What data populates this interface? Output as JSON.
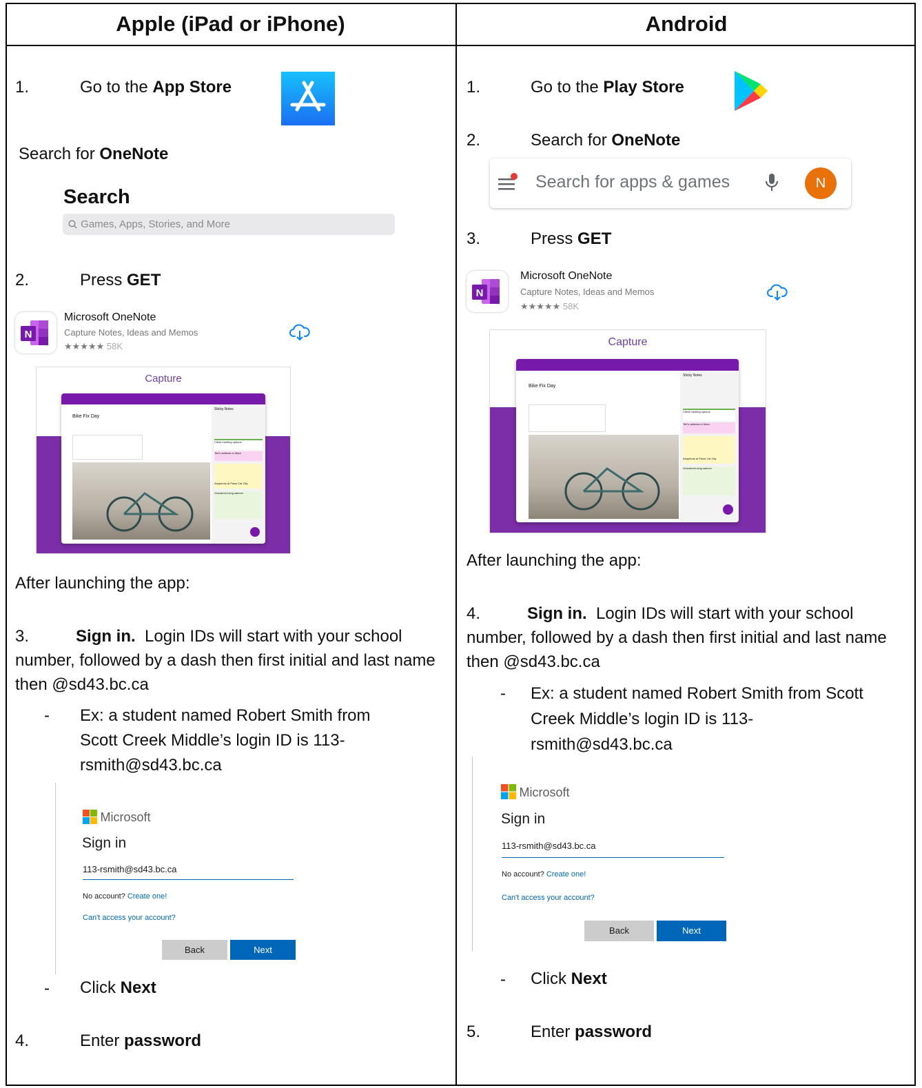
{
  "headers": {
    "apple": "Apple (iPad or iPhone)",
    "android": "Android"
  },
  "apple": {
    "step1_num": "1.",
    "step1_pre": "Go to the ",
    "step1_bold": "App Store",
    "search_pre": "Search for ",
    "search_bold": "OneNote",
    "ios_search_title": "Search",
    "ios_search_placeholder": "Games, Apps, Stories, and More",
    "step2_num": "2.",
    "step2_pre": "Press ",
    "step2_bold": "GET",
    "after": "After launching the app:",
    "step3_num": "3.",
    "step3_bold": "Sign in.",
    "step3_text": "Login IDs will start with your school number, followed by a dash then first initial and last name then @sd43.bc.ca",
    "example": "Ex: a student named Robert Smith from Scott Creek Middle’s login ID is  113-rsmith@sd43.bc.ca",
    "dash": "-",
    "click_pre": "Click ",
    "click_bold": "Next",
    "step4_num": "4.",
    "step4_pre": "Enter ",
    "step4_bold": "password"
  },
  "android": {
    "step1_num": "1.",
    "step1_pre": "Go to the ",
    "step1_bold": "Play Store",
    "step2_num": "2.",
    "step2_pre": "Search for ",
    "step2_bold": "OneNote",
    "gp_search_placeholder": "Search for apps & games",
    "avatar_letter": "N",
    "step3_num": "3.",
    "step3_pre": "Press ",
    "step3_bold": "GET",
    "after": "After launching the app:",
    "step4_num": "4.",
    "step4_bold": "Sign in.",
    "step4_text": "Login IDs will start with your school number, followed by a dash then first initial and last name then @sd43.bc.ca",
    "example": "Ex: a student named Robert Smith from Scott Creek Middle’s login ID is  113-rsmith@sd43.bc.ca",
    "dash": "-",
    "click_pre": "Click ",
    "click_bold": "Next",
    "step5_num": "5.",
    "step5_pre": "Enter ",
    "step5_bold": "password"
  },
  "app_listing": {
    "name": "Microsoft OneNote",
    "subtitle": "Capture Notes, Ideas and Memos",
    "stars": "★★★★★",
    "rating_count": "58K",
    "icon_letter": "N",
    "capture_label": "Capture",
    "page_title": "Bike Fix Day",
    "sticky_header": "Sticky Notes",
    "note1": "Client meeting options",
    "note2": "Teri's address in Maui",
    "note3": "Adoptions at Paws Cat City",
    "note4": "Grandma's king salmon"
  },
  "signin": {
    "brand": "Microsoft",
    "title": "Sign in",
    "input_value": "113-rsmith@sd43.bc.ca",
    "no_account": "No account?",
    "create": "Create one!",
    "cant_access": "Can't access your account?",
    "back": "Back",
    "next": "Next"
  },
  "colors": {
    "onenote_purple": "#7719aa",
    "ms_blue": "#0067b8",
    "appstore_blue": "#1a8cf0",
    "avatar_orange": "#e8710a"
  }
}
